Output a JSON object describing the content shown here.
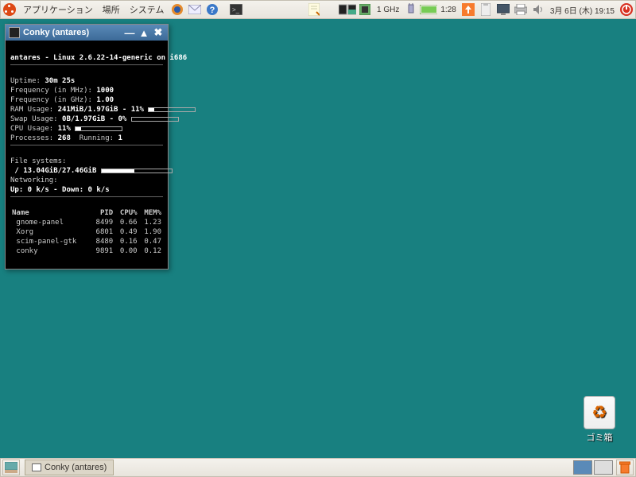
{
  "top": {
    "menus": [
      "アプリケーション",
      "場所",
      "システム"
    ],
    "cpu_freq": "1 GHz",
    "battery": "1:28",
    "date": "3月 6日 (木) 19:15"
  },
  "conky": {
    "title": "Conky (antares)",
    "header": "antares - Linux 2.6.22-14-generic on i686",
    "uptime_label": "Uptime:",
    "uptime": "30m 25s",
    "freq_mhz_label": "Frequency (in MHz):",
    "freq_mhz": "1000",
    "freq_ghz_label": "Frequency (in GHz):",
    "freq_ghz": "1.00",
    "ram_label": "RAM Usage:",
    "ram": "241MiB/1.97GiB - 11%",
    "ram_pct": 11,
    "swap_label": "Swap Usage:",
    "swap": "0B/1.97GiB - 0%",
    "swap_pct": 0,
    "cpu_label": "CPU Usage:",
    "cpu": "11%",
    "cpu_pct": 11,
    "proc_label": "Processes:",
    "proc": "268",
    "run_label": "Running:",
    "run": "1",
    "fs_label": "File systems:",
    "fs": "/ 13.04GiB/27.46GiB",
    "fs_pct": 47,
    "net_label": "Networking:",
    "net": "Up: 0 k/s - Down: 0 k/s",
    "headers": {
      "name": "Name",
      "pid": "PID",
      "cpu": "CPU%",
      "mem": "MEM%"
    },
    "procs": [
      {
        "name": "gnome-panel",
        "pid": "8499",
        "cpu": "0.66",
        "mem": "1.23"
      },
      {
        "name": "Xorg",
        "pid": "6801",
        "cpu": "0.49",
        "mem": "1.90"
      },
      {
        "name": "scim-panel-gtk",
        "pid": "8480",
        "cpu": "0.16",
        "mem": "0.47"
      },
      {
        "name": "conky",
        "pid": "9891",
        "cpu": "0.00",
        "mem": "0.12"
      }
    ]
  },
  "trash_label": "ゴミ箱",
  "taskbar_item": "Conky (antares)"
}
